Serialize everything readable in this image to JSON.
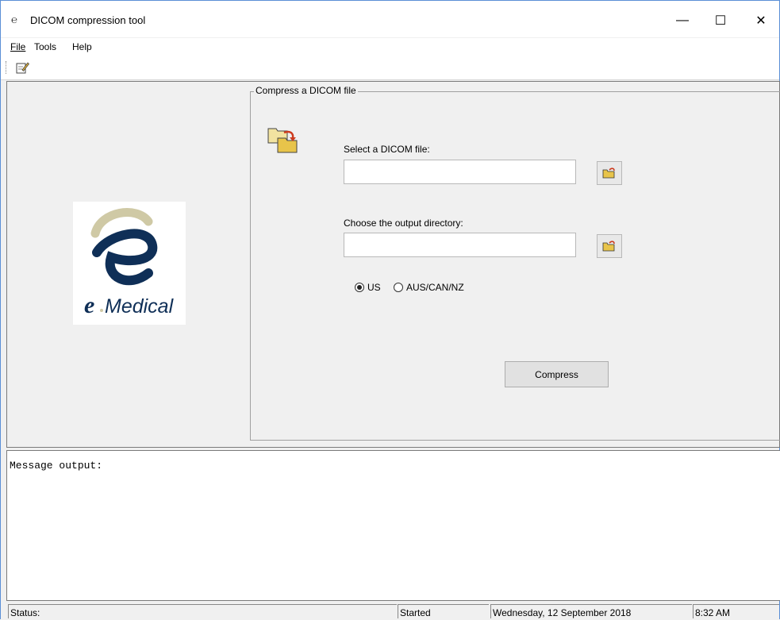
{
  "window": {
    "title": "DICOM compression tool",
    "min_glyph": "—",
    "max_glyph": "☐",
    "close_glyph": "✕"
  },
  "menu": {
    "file": "File",
    "tools": "Tools",
    "help": "Help"
  },
  "logo": {
    "brand": "Medical"
  },
  "group": {
    "legend": "Compress a DICOM file",
    "dicom_label": "Select a DICOM file:",
    "dicom_value": "",
    "output_label": "Choose the output directory:",
    "output_value": "",
    "radio_us": "US",
    "radio_aus": "AUS/CAN/NZ",
    "selected_region": "US",
    "compress_label": "Compress"
  },
  "messages": {
    "header": "Message output:"
  },
  "status": {
    "label": "Status:",
    "state": "Started",
    "date": "Wednesday, 12 September 2018",
    "time": "8:32 AM"
  },
  "colors": {
    "logo_blue": "#0f2f57",
    "logo_tan": "#cfc9a5",
    "folder_yellow": "#e8c44a",
    "arrow_red": "#cc3b1e"
  }
}
